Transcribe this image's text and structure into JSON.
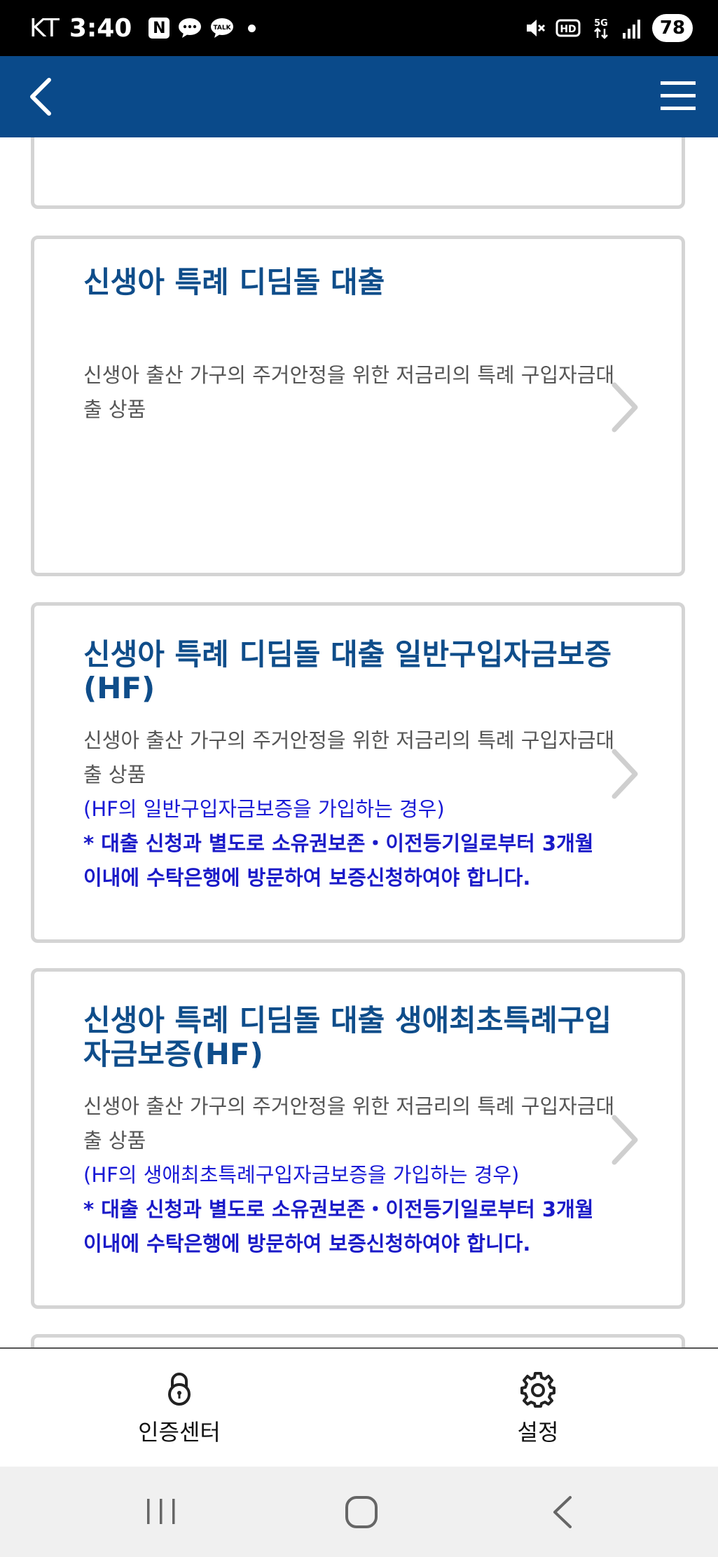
{
  "status_bar": {
    "carrier": "KT",
    "time": "3:40",
    "notif_n": "N",
    "battery": "78",
    "icons": [
      "n-icon",
      "chat-icon",
      "talk-icon",
      "dot-icon",
      "mute-icon",
      "hd-icon",
      "5g-icon",
      "signal-icon",
      "battery-icon"
    ]
  },
  "header": {
    "back_icon": "chevron-left-icon",
    "menu_icon": "hamburger-menu-icon",
    "color": "#0a4a8a"
  },
  "cards": [
    {
      "title": "신생아 특례 디딤돌 대출",
      "desc": "신생아 출산 가구의 주거안정을 위한 저금리의 특례 구입자금대출 상품"
    },
    {
      "title": "신생아 특례 디딤돌 대출 일반구입자금보증(HF)",
      "desc": "신생아 출산 가구의 주거안정을 위한 저금리의 특례 구입자금대출 상품",
      "note": "(HF의 일반구입자금보증을 가입하는 경우)",
      "warning": "* 대출 신청과 별도로 소유권보존・이전등기일로부터 3개월 이내에 수탁은행에 방문하여 보증신청하여야 합니다."
    },
    {
      "title": "신생아 특례 디딤돌 대출 생애최초특례구입자금보증(HF)",
      "desc": "신생아 출산 가구의 주거안정을 위한 저금리의 특례 구입자금대출 상품",
      "note": "(HF의 생애최초특례구입자금보증을 가입하는 경우)",
      "warning": "* 대출 신청과 별도로 소유권보존・이전등기일로부터 3개월 이내에 수탁은행에 방문하여 보증신청하여야 합니다."
    }
  ],
  "bottom_nav": {
    "auth_center": "인증센터",
    "settings": "설정"
  },
  "colors": {
    "title": "#0f4d8a",
    "note": "#1a1ad6",
    "card_border": "#d4d4d4"
  }
}
